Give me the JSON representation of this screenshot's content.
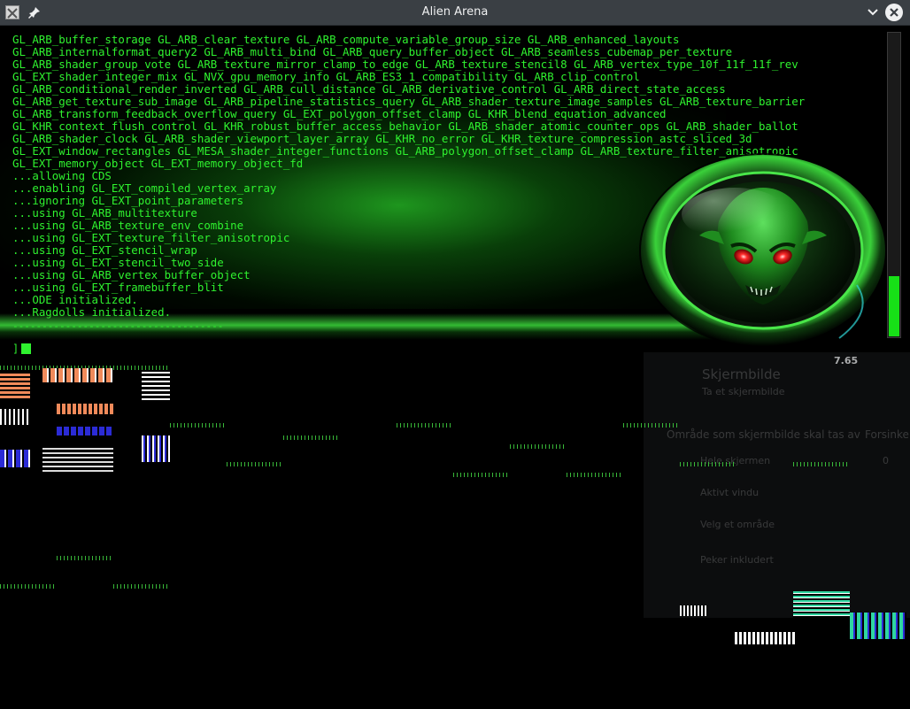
{
  "window": {
    "title": "Alien Arena"
  },
  "icons": {
    "app": "x-window-icon",
    "pin": "pin-icon",
    "chevron": "chevron-down-icon",
    "close": "close-icon",
    "logo": "alien-head-logo"
  },
  "colors": {
    "console_text": "#2ff22f",
    "titlebar": "#3a3f44",
    "scrollbar_fill": "#17e017",
    "alien_eyes": "#ff2a2a"
  },
  "console": {
    "lines": [
      "GL_ARB_buffer_storage GL_ARB_clear_texture GL_ARB_compute_variable_group_size GL_ARB_enhanced_layouts",
      "GL_ARB_internalformat_query2 GL_ARB_multi_bind GL_ARB_query_buffer_object GL_ARB_seamless_cubemap_per_texture",
      "GL_ARB_shader_group_vote GL_ARB_texture_mirror_clamp_to_edge GL_ARB_texture_stencil8 GL_ARB_vertex_type_10f_11f_11f_rev",
      "GL_EXT_shader_integer_mix GL_NVX_gpu_memory_info GL_ARB_ES3_1_compatibility GL_ARB_clip_control",
      "GL_ARB_conditional_render_inverted GL_ARB_cull_distance GL_ARB_derivative_control GL_ARB_direct_state_access",
      "GL_ARB_get_texture_sub_image GL_ARB_pipeline_statistics_query GL_ARB_shader_texture_image_samples GL_ARB_texture_barrier",
      "GL_ARB_transform_feedback_overflow_query GL_EXT_polygon_offset_clamp GL_KHR_blend_equation_advanced",
      "GL_KHR_context_flush_control GL_KHR_robust_buffer_access_behavior GL_ARB_shader_atomic_counter_ops GL_ARB_shader_ballot",
      "GL_ARB_shader_clock GL_ARB_shader_viewport_layer_array GL_KHR_no_error GL_KHR_texture_compression_astc_sliced_3d",
      "GL_EXT_window_rectangles GL_MESA_shader_integer_functions GL_ARB_polygon_offset_clamp GL_ARB_texture_filter_anisotropic",
      "GL_EXT_memory_object GL_EXT_memory_object_fd",
      "...allowing CDS",
      "...enabling GL_EXT_compiled_vertex_array",
      "...ignoring GL_EXT_point_parameters",
      "...using GL_ARB_multitexture",
      "...using GL_ARB_texture_env_combine",
      "...using GL_EXT_texture_filter_anisotropic",
      "...using GL_EXT_stencil_wrap",
      "...using GL_EXT_stencil_two_side",
      "...using GL_ARB_vertex_buffer_object",
      "...using GL_EXT_framebuffer_blit",
      "...ODE initialized.",
      "...Ragdolls initialized."
    ],
    "separator": "------------------------------------",
    "prompt": "]",
    "fps": "7.65",
    "scroll_fill": 0.2
  },
  "ghost_overlay": {
    "title": "Skjermbilde",
    "subtitle": "Ta et skjermbilde",
    "area_label": "Område som skjermbilde skal tas av",
    "delay_label": "Forsinkelse",
    "option_fullscreen": "Hele skjermen",
    "option_window": "Aktivt vindu",
    "option_region": "Velg et område",
    "option_pointer": "Peker inkludert",
    "delay_value": "0"
  }
}
